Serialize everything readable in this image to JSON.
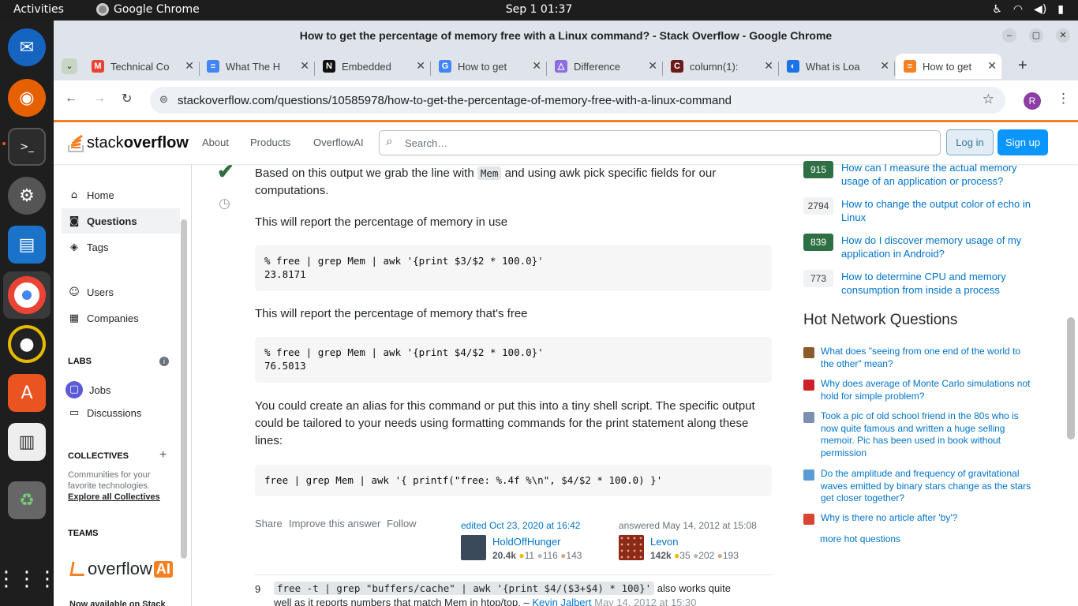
{
  "os": {
    "activities": "Activities",
    "app_name": "Google Chrome",
    "clock": "Sep 1  01:37"
  },
  "window": {
    "title": "How to get the percentage of memory free with a Linux command? - Stack Overflow - Google Chrome"
  },
  "tabs": [
    {
      "label": "Technical Co",
      "icon": "gmail-icon",
      "color": "#ea4335",
      "glyph": "M"
    },
    {
      "label": "What The H",
      "icon": "docs-icon",
      "color": "#4285f4",
      "glyph": "≡"
    },
    {
      "label": "Embedded",
      "icon": "notion-icon",
      "color": "#111111",
      "glyph": "N"
    },
    {
      "label": "How to get",
      "icon": "google-icon",
      "color": "#4285f4",
      "glyph": "G"
    },
    {
      "label": "Difference",
      "icon": "arch-icon",
      "color": "#8b6ee0",
      "glyph": "△"
    },
    {
      "label": "column(1):",
      "icon": "man-icon",
      "color": "#6b1a1a",
      "glyph": "C"
    },
    {
      "label": "What is Loa",
      "icon": "loa-icon",
      "color": "#1a73e8",
      "glyph": "◐"
    },
    {
      "label": "How to get",
      "icon": "stackoverflow-icon",
      "color": "#f48024",
      "glyph": "≡"
    }
  ],
  "address": {
    "url": "stackoverflow.com/questions/10585978/how-to-get-the-percentage-of-memory-free-with-a-linux-command",
    "profile": "R"
  },
  "so": {
    "logo_a": "stack",
    "logo_b": "overflow",
    "nav": [
      "About",
      "Products",
      "OverflowAI"
    ],
    "search_placeholder": "Search…",
    "login": "Log in",
    "signup": "Sign up"
  },
  "leftnav": {
    "home": "Home",
    "questions": "Questions",
    "tags": "Tags",
    "users": "Users",
    "companies": "Companies",
    "labs": "LABS",
    "jobs": "Jobs",
    "discussions": "Discussions",
    "collectives": "COLLECTIVES",
    "collectives_desc_1": "Communities for your",
    "collectives_desc_2": "favorite technologies.",
    "explore": "Explore all Collectives",
    "teams": "TEAMS",
    "overflowai_a": "overflow",
    "overflowai_b": "AI",
    "now_available": "Now available on Stack"
  },
  "answer": {
    "p1_a": "Based on this output we grab the line with ",
    "p1_code": "Mem",
    "p1_b": " and using awk pick specific fields for our",
    "p1_c": "computations.",
    "p2": "This will report the percentage of memory in use",
    "code1": "% free | grep Mem | awk '{print $3/$2 * 100.0}'\n23.8171",
    "p3": "This will report the percentage of memory that's free",
    "code2": "% free | grep Mem | awk '{print $4/$2 * 100.0}'\n76.5013",
    "p4_a": "You could create an alias for this command or put this into a tiny shell script. The specific output",
    "p4_b": "could be tailored to your needs using formatting commands for the print statement along these",
    "p4_c": "lines:",
    "code3": "free | grep Mem | awk '{ printf(\"free: %.4f %\\n\", $4/$2 * 100.0) }'",
    "share": "Share",
    "improve": "Improve this answer",
    "follow": "Follow",
    "edited": "edited Oct 23, 2020 at 16:42",
    "editor": "HoldOffHunger",
    "editor_rep": "20.4k",
    "editor_gold": "11",
    "editor_silver": "116",
    "editor_bronze": "143",
    "answered": "answered May 14, 2012 at 15:08",
    "author": "Levon",
    "author_rep": "142k",
    "author_gold": "35",
    "author_silver": "202",
    "author_bronze": "193"
  },
  "comment": {
    "score": "9",
    "code": "free -t | grep \"buffers/cache\" | awk '{print $4/($3+$4) * 100}'",
    "text_a": "also works quite",
    "text_b": "well as it reports numbers that match Mem in htop/top. –",
    "user": "Kevin Jalbert",
    "date": "May 14, 2012 at 15:30"
  },
  "related": [
    {
      "score": "915",
      "title_1": "How can I measure the actual memory",
      "title_2": "usage of an application or process?",
      "answered": true
    },
    {
      "score": "2794",
      "title_1": "How to change the output color of echo in",
      "title_2": "Linux",
      "answered": false
    },
    {
      "score": "839",
      "title_1": "How do I discover memory usage of my",
      "title_2": "application in Android?",
      "answered": true
    },
    {
      "score": "773",
      "title_1": "How to determine CPU and memory",
      "title_2": "consumption from inside a process",
      "answered": false
    }
  ],
  "hnq": {
    "heading": "Hot Network Questions",
    "items": [
      {
        "text": "What does \"seeing from one end of the world to the other\" mean?",
        "color": "#8b5a2b"
      },
      {
        "text": "Why does average of Monte Carlo simulations not hold for simple problem?",
        "color": "#cc1f2a"
      },
      {
        "text": "Took a pic of old school friend in the 80s who is now quite famous and written a huge selling memoir. Pic has been used in book without permission",
        "color": "#7b8fb0"
      },
      {
        "text": "Do the amplitude and frequency of gravitational waves emitted by binary stars change as the stars get closer together?",
        "color": "#5b9bd5"
      },
      {
        "text": "Why is there no article after 'by'?",
        "color": "#d9432f"
      }
    ],
    "more": "more hot questions"
  }
}
